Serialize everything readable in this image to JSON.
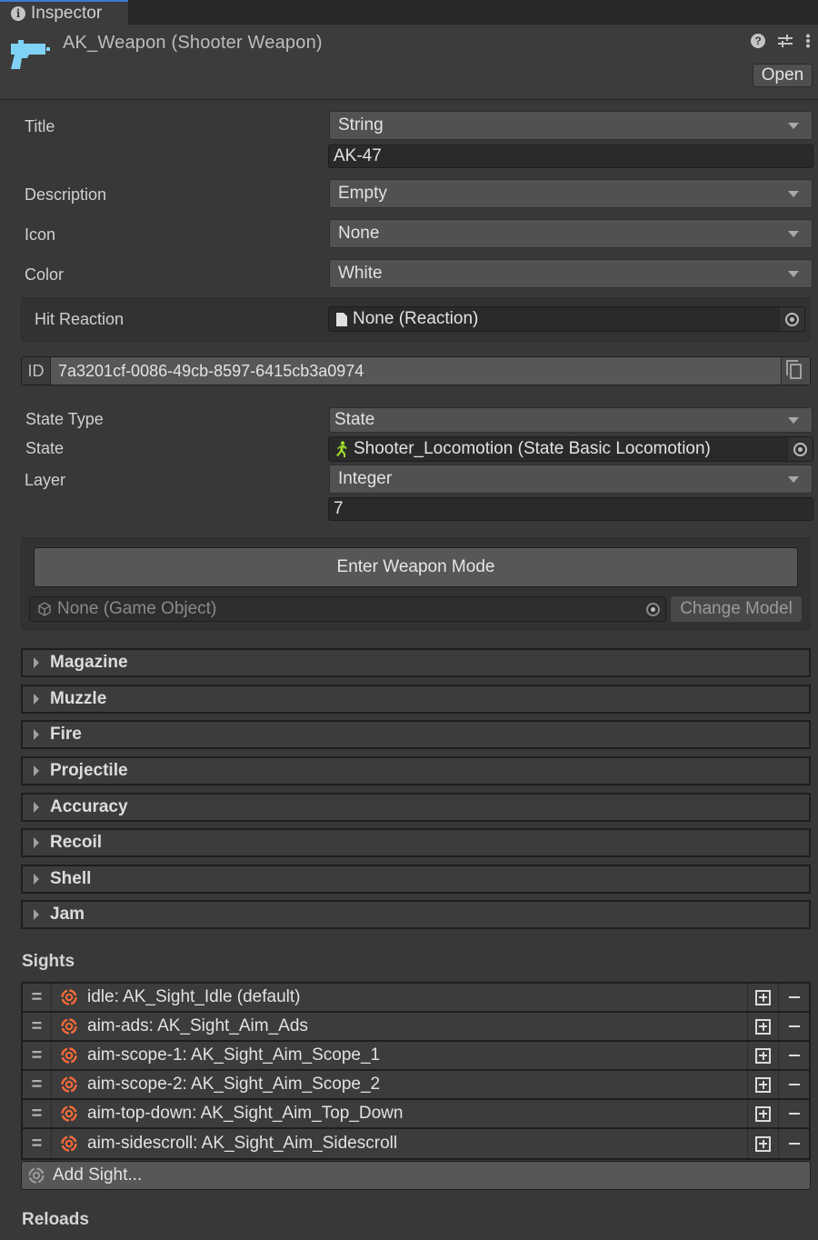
{
  "tab": {
    "label": "Inspector",
    "icon": "info-icon"
  },
  "header": {
    "title": "AK_Weapon (Shooter Weapon)",
    "icon": "pistol-icon",
    "icon_color": "#7fd2f6",
    "open_label": "Open",
    "actions": [
      "help-icon",
      "settings-sliders-icon",
      "more-vertical-icon"
    ]
  },
  "fields": {
    "title": {
      "label": "Title",
      "type": "String",
      "value": "AK-47"
    },
    "description": {
      "label": "Description",
      "value": "Empty"
    },
    "icon": {
      "label": "Icon",
      "value": "None"
    },
    "color": {
      "label": "Color",
      "value": "White"
    },
    "hit_reaction": {
      "label": "Hit Reaction",
      "value": "None (Reaction)"
    },
    "id": {
      "label": "ID",
      "value": "7a3201cf-0086-49cb-8597-6415cb3a0974"
    },
    "state_type": {
      "label": "State Type",
      "value": "State"
    },
    "state": {
      "label": "State",
      "value": "Shooter_Locomotion (State Basic Locomotion)",
      "icon_color": "#9fdc2e"
    },
    "layer": {
      "label": "Layer",
      "type": "Integer",
      "value": "7"
    }
  },
  "weapon_mode": {
    "button_label": "Enter Weapon Mode",
    "model_field": "None (Game Object)",
    "change_model_label": "Change Model"
  },
  "foldouts": [
    "Magazine",
    "Muzzle",
    "Fire",
    "Projectile",
    "Accuracy",
    "Recoil",
    "Shell",
    "Jam"
  ],
  "sights": {
    "title": "Sights",
    "icon_color": "#f26a3a",
    "items": [
      "idle: AK_Sight_Idle (default)",
      "aim-ads: AK_Sight_Aim_Ads",
      "aim-scope-1: AK_Sight_Aim_Scope_1",
      "aim-scope-2: AK_Sight_Aim_Scope_2",
      "aim-top-down: AK_Sight_Aim_Top_Down",
      "aim-sidescroll: AK_Sight_Aim_Sidescroll"
    ],
    "add_label": "Add Sight..."
  },
  "reloads": {
    "title": "Reloads"
  }
}
